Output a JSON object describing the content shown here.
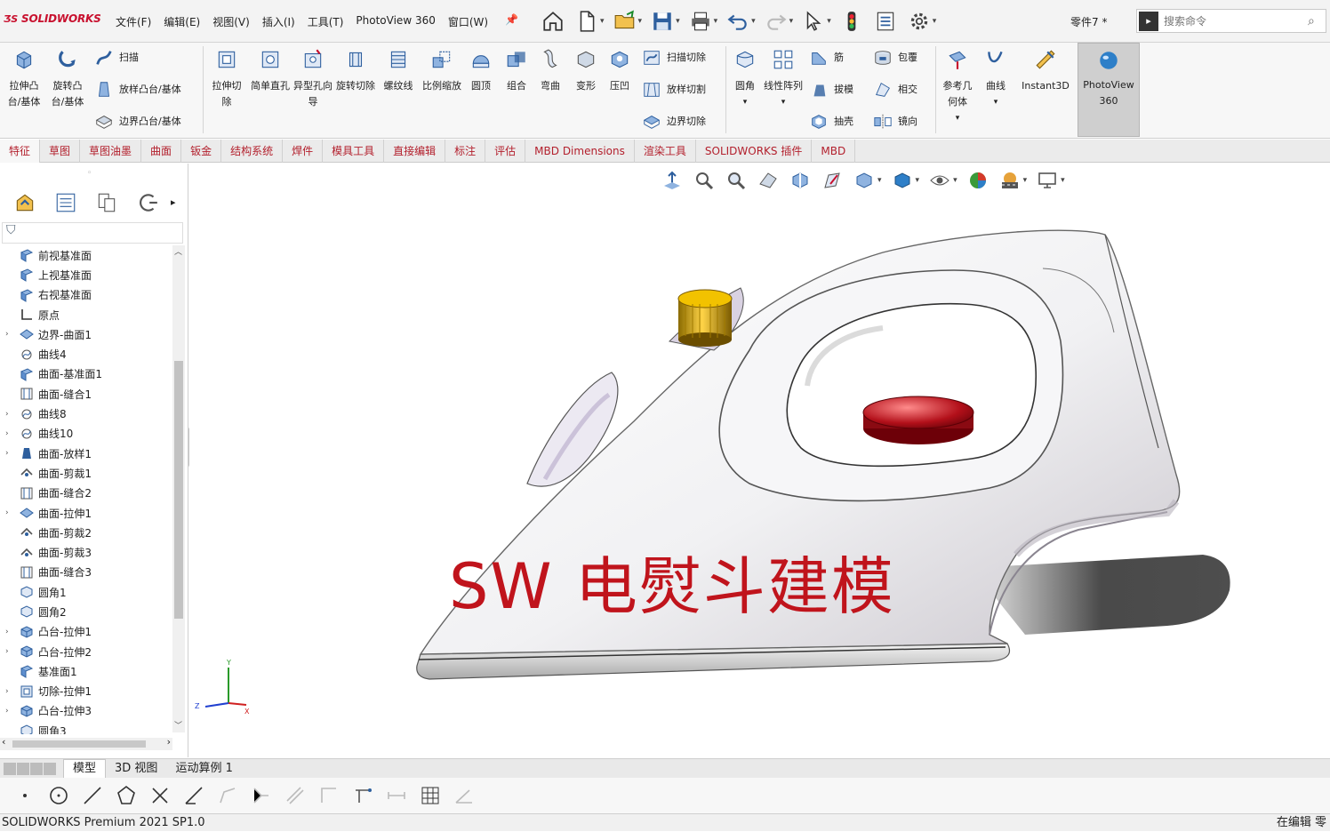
{
  "app": {
    "logo_text": "SOLIDWORKS",
    "document_name": "零件7 *",
    "edition": "SOLIDWORKS Premium 2021 SP1.0",
    "status_right": "在编辑 零"
  },
  "menu": [
    "文件(F)",
    "编辑(E)",
    "视图(V)",
    "插入(I)",
    "工具(T)",
    "PhotoView 360",
    "窗口(W)"
  ],
  "search": {
    "placeholder": "搜索命令"
  },
  "ribbon": {
    "extrude_boss": "拉伸凸台/基体",
    "revolve_boss": "旋转凸台/基体",
    "sweep": "扫描",
    "loft_boss": "放样凸台/基体",
    "boundary_boss": "边界凸台/基体",
    "extrude_cut": "拉伸切除",
    "hole_simple": "简单直孔",
    "hole_wizard": "异型孔向导",
    "revolve_cut": "旋转切除",
    "helix": "螺纹线",
    "scale": "比例缩放",
    "dome": "圆顶",
    "combine": "组合",
    "flex": "弯曲",
    "deform": "变形",
    "indent": "压凹",
    "swept_cut": "扫描切除",
    "lofted_cut": "放样切割",
    "boundary_cut": "边界切除",
    "fillet": "圆角",
    "linear_pattern": "线性阵列",
    "rib": "筋",
    "wrap": "包覆",
    "draft": "拔模",
    "intersect": "相交",
    "shell": "抽壳",
    "mirror": "镜向",
    "ref_geometry": "参考几何体",
    "curves": "曲线",
    "instant3d": "Instant3D",
    "photoview": "PhotoView 360"
  },
  "tabs": [
    "特征",
    "草图",
    "草图油墨",
    "曲面",
    "钣金",
    "结构系统",
    "焊件",
    "模具工具",
    "直接编辑",
    "标注",
    "评估",
    "MBD Dimensions",
    "渲染工具",
    "SOLIDWORKS 插件",
    "MBD"
  ],
  "tree": [
    {
      "label": "前视基准面",
      "icon": "plane-icon",
      "expandable": false
    },
    {
      "label": "上视基准面",
      "icon": "plane-icon",
      "expandable": false
    },
    {
      "label": "右视基准面",
      "icon": "plane-icon",
      "expandable": false
    },
    {
      "label": "原点",
      "icon": "origin-icon",
      "expandable": false
    },
    {
      "label": "边界-曲面1",
      "icon": "surface-icon",
      "expandable": true
    },
    {
      "label": "曲线4",
      "icon": "curve-icon",
      "expandable": false
    },
    {
      "label": "曲面-基准面1",
      "icon": "plane-icon",
      "expandable": false
    },
    {
      "label": "曲面-缝合1",
      "icon": "knit-icon",
      "expandable": false
    },
    {
      "label": "曲线8",
      "icon": "curve-icon",
      "expandable": true
    },
    {
      "label": "曲线10",
      "icon": "curve-icon",
      "expandable": true
    },
    {
      "label": "曲面-放样1",
      "icon": "loft-icon",
      "expandable": true
    },
    {
      "label": "曲面-剪裁1",
      "icon": "trim-icon",
      "expandable": false
    },
    {
      "label": "曲面-缝合2",
      "icon": "knit-icon",
      "expandable": false
    },
    {
      "label": "曲面-拉伸1",
      "icon": "surface-icon",
      "expandable": true
    },
    {
      "label": "曲面-剪裁2",
      "icon": "trim-icon",
      "expandable": false
    },
    {
      "label": "曲面-剪裁3",
      "icon": "trim-icon",
      "expandable": false
    },
    {
      "label": "曲面-缝合3",
      "icon": "knit-icon",
      "expandable": false
    },
    {
      "label": "圆角1",
      "icon": "fillet-icon",
      "expandable": false
    },
    {
      "label": "圆角2",
      "icon": "fillet-icon",
      "expandable": false
    },
    {
      "label": "凸台-拉伸1",
      "icon": "extrude-icon",
      "expandable": true
    },
    {
      "label": "凸台-拉伸2",
      "icon": "extrude-icon",
      "expandable": true
    },
    {
      "label": "基准面1",
      "icon": "plane-icon",
      "expandable": false
    },
    {
      "label": "切除-拉伸1",
      "icon": "cut-icon",
      "expandable": true
    },
    {
      "label": "凸台-拉伸3",
      "icon": "extrude-icon",
      "expandable": true
    },
    {
      "label": "圆角3",
      "icon": "fillet-icon",
      "expandable": false
    }
  ],
  "viewport": {
    "watermark": "SW 电熨斗建模",
    "triad_x": "X",
    "triad_y": "Y",
    "triad_z": "Z"
  },
  "bottom_tabs": [
    "模型",
    "3D 视图",
    "运动算例 1"
  ],
  "colors": {
    "accent_red": "#c0141c",
    "tab_text": "#b3202d"
  }
}
